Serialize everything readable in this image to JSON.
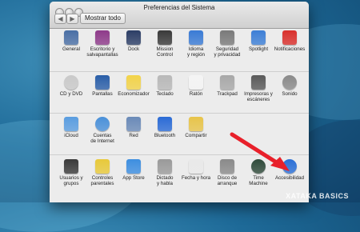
{
  "window": {
    "title": "Preferencias del Sistema",
    "show_all_label": "Mostrar todo",
    "back_symbol": "◀",
    "forward_symbol": "▶"
  },
  "sections": [
    {
      "items": [
        {
          "label": "General",
          "icon": "general-icon",
          "color": "#4a6fa5"
        },
        {
          "label": "Escritorio y\nsalvapantallas",
          "icon": "desktop-icon",
          "color": "#8e3a8a"
        },
        {
          "label": "Dock",
          "icon": "dock-icon",
          "color": "#2c3e66"
        },
        {
          "label": "Mission\nControl",
          "icon": "mission-control-icon",
          "color": "#3a3a3a"
        },
        {
          "label": "Idioma\ny región",
          "icon": "language-icon",
          "color": "#3a7bd5"
        },
        {
          "label": "Seguridad\ny privacidad",
          "icon": "security-icon",
          "color": "#7a7a7a"
        },
        {
          "label": "Spotlight",
          "icon": "spotlight-icon",
          "color": "#3d7fd6"
        },
        {
          "label": "Notificaciones",
          "icon": "notifications-icon",
          "color": "#d9302c"
        }
      ]
    },
    {
      "items": [
        {
          "label": "CD y DVD",
          "icon": "cd-dvd-icon",
          "color": "#c9c9c9"
        },
        {
          "label": "Pantallas",
          "icon": "displays-icon",
          "color": "#2a5ea8"
        },
        {
          "label": "Economizador",
          "icon": "energy-saver-icon",
          "color": "#f2d34a"
        },
        {
          "label": "Teclado",
          "icon": "keyboard-icon",
          "color": "#b8b8b8"
        },
        {
          "label": "Ratón",
          "icon": "mouse-icon",
          "color": "#f4f4f4"
        },
        {
          "label": "Trackpad",
          "icon": "trackpad-icon",
          "color": "#a8a8a8"
        },
        {
          "label": "Impresoras y\nescáneres",
          "icon": "printer-icon",
          "color": "#5a5a5a"
        },
        {
          "label": "Sonido",
          "icon": "sound-icon",
          "color": "#8a8a8a"
        }
      ]
    },
    {
      "items": [
        {
          "label": "iCloud",
          "icon": "icloud-icon",
          "color": "#5a9de0"
        },
        {
          "label": "Cuentas\nde Internet",
          "icon": "internet-accounts-icon",
          "color": "#4a90d9"
        },
        {
          "label": "Red",
          "icon": "network-icon",
          "color": "#6a8ab8"
        },
        {
          "label": "Bluetooth",
          "icon": "bluetooth-icon",
          "color": "#2b6bd6"
        },
        {
          "label": "Compartir",
          "icon": "sharing-icon",
          "color": "#e8c44a"
        }
      ]
    },
    {
      "items": [
        {
          "label": "Usuarios y\ngrupos",
          "icon": "users-icon",
          "color": "#3a3a3a"
        },
        {
          "label": "Controles\nparentales",
          "icon": "parental-controls-icon",
          "color": "#e8c93a"
        },
        {
          "label": "App Store",
          "icon": "app-store-icon",
          "color": "#3d8ee0"
        },
        {
          "label": "Dictado\ny habla",
          "icon": "dictation-icon",
          "color": "#9a9a9a"
        },
        {
          "label": "Fecha y hora",
          "icon": "date-time-icon",
          "color": "#e9e9e9"
        },
        {
          "label": "Disco de\narranque",
          "icon": "startup-disk-icon",
          "color": "#8a8a8a"
        },
        {
          "label": "Time\nMachine",
          "icon": "time-machine-icon",
          "color": "#2f4a3a"
        },
        {
          "label": "Accesibilidad",
          "icon": "accessibility-icon",
          "color": "#2a6fd6"
        }
      ]
    }
  ],
  "annotation": {
    "arrow_color": "#e8202a"
  },
  "watermark": "XATAKA BASICS"
}
